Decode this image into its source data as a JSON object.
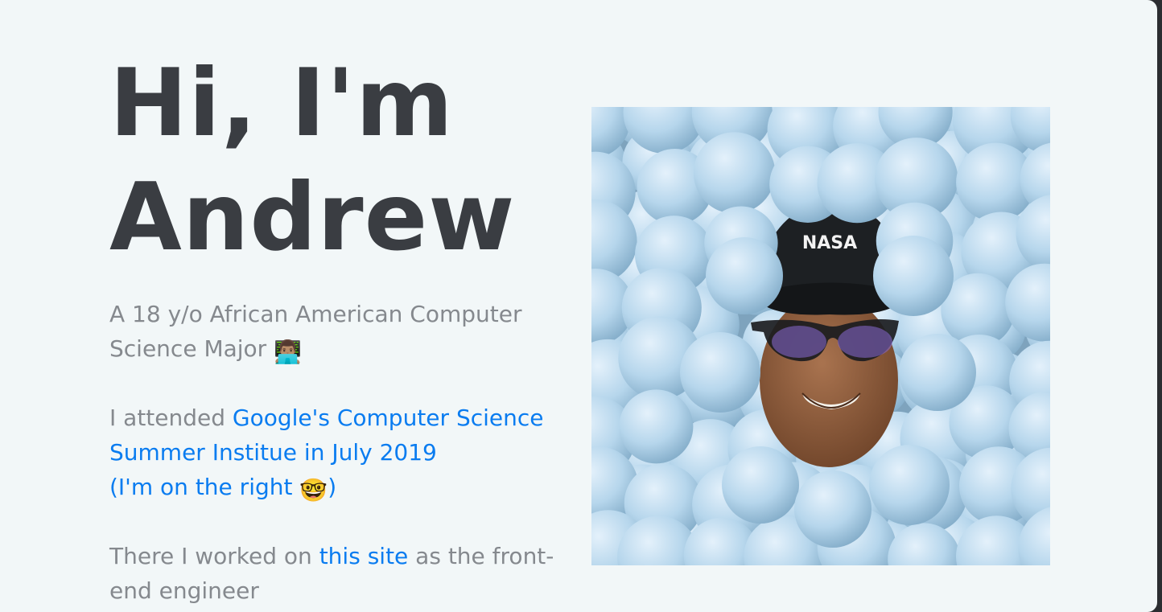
{
  "hero": {
    "greeting": "Hi, I'm",
    "name": "Andrew"
  },
  "bio": {
    "text": "A 18 y/o African American Computer Science Major",
    "emoji": "👨🏽‍💻"
  },
  "google": {
    "prefix": "I attended ",
    "link": "Google's Computer Science Summer Institue in July 2019",
    "note": "(I'm on the right ",
    "note_emoji": "🤓",
    "note_close": ")"
  },
  "worked": {
    "prefix": "There I worked on ",
    "link": "this site",
    "suffix": " as the front-end engineer"
  },
  "photo": {
    "subject": "portrait-in-ball-pit",
    "cap_text": "NASA"
  },
  "colors": {
    "background": "#f2f7f8",
    "heading": "#3a3d42",
    "body_text": "#85898e",
    "link": "#0a7cf0",
    "ball": "#b5d4ea"
  }
}
